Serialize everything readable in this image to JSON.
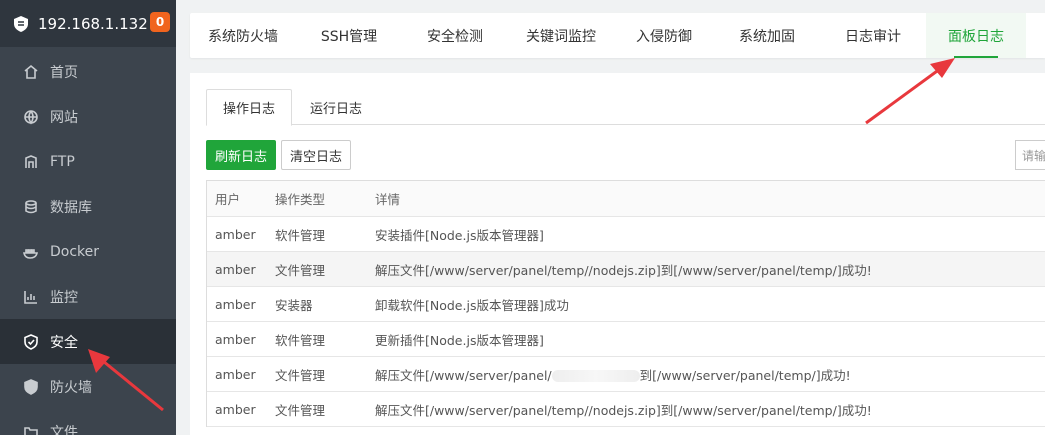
{
  "sidebar": {
    "ip": "192.168.1.132",
    "badge": "0",
    "items": [
      {
        "label": "首页",
        "icon": "home-icon"
      },
      {
        "label": "网站",
        "icon": "globe-icon"
      },
      {
        "label": "FTP",
        "icon": "ftp-icon"
      },
      {
        "label": "数据库",
        "icon": "database-icon"
      },
      {
        "label": "Docker",
        "icon": "docker-icon"
      },
      {
        "label": "监控",
        "icon": "monitor-icon"
      },
      {
        "label": "安全",
        "icon": "shield-icon"
      },
      {
        "label": "防火墙",
        "icon": "firewall-icon"
      },
      {
        "label": "文件",
        "icon": "folder-icon"
      }
    ],
    "active_index": 6
  },
  "topnav": {
    "tabs": [
      "系统防火墙",
      "SSH管理",
      "安全检测",
      "关键词监控",
      "入侵防御",
      "系统加固",
      "日志审计",
      "面板日志"
    ],
    "active_index": 7
  },
  "subtabs": [
    "操作日志",
    "运行日志"
  ],
  "buttons": {
    "refresh": "刷新日志",
    "clear": "清空日志"
  },
  "search": {
    "placeholder": "请输入"
  },
  "table": {
    "columns": [
      "用户",
      "操作类型",
      "详情"
    ],
    "rows": [
      {
        "user": "amber",
        "type": "软件管理",
        "detail": "安装插件[Node.js版本管理器]"
      },
      {
        "user": "amber",
        "type": "文件管理",
        "detail": "解压文件[/www/server/panel/temp//nodejs.zip]到[/www/server/panel/temp/]成功!"
      },
      {
        "user": "amber",
        "type": "安装器",
        "detail": "卸载软件[Node.js版本管理器]成功"
      },
      {
        "user": "amber",
        "type": "软件管理",
        "detail": "更新插件[Node.js版本管理器]"
      },
      {
        "user": "amber",
        "type": "文件管理",
        "detail_pre": "解压文件[/www/server/panel/",
        "detail_post": "到[/www/server/panel/temp/]成功!"
      },
      {
        "user": "amber",
        "type": "文件管理",
        "detail": "解压文件[/www/server/panel/temp//nodejs.zip]到[/www/server/panel/temp/]成功!"
      }
    ]
  },
  "colors": {
    "accent": "#20a53a",
    "sidebar_bg": "#3c444d",
    "badge": "#f0641e",
    "arrow": "#e8383d"
  }
}
